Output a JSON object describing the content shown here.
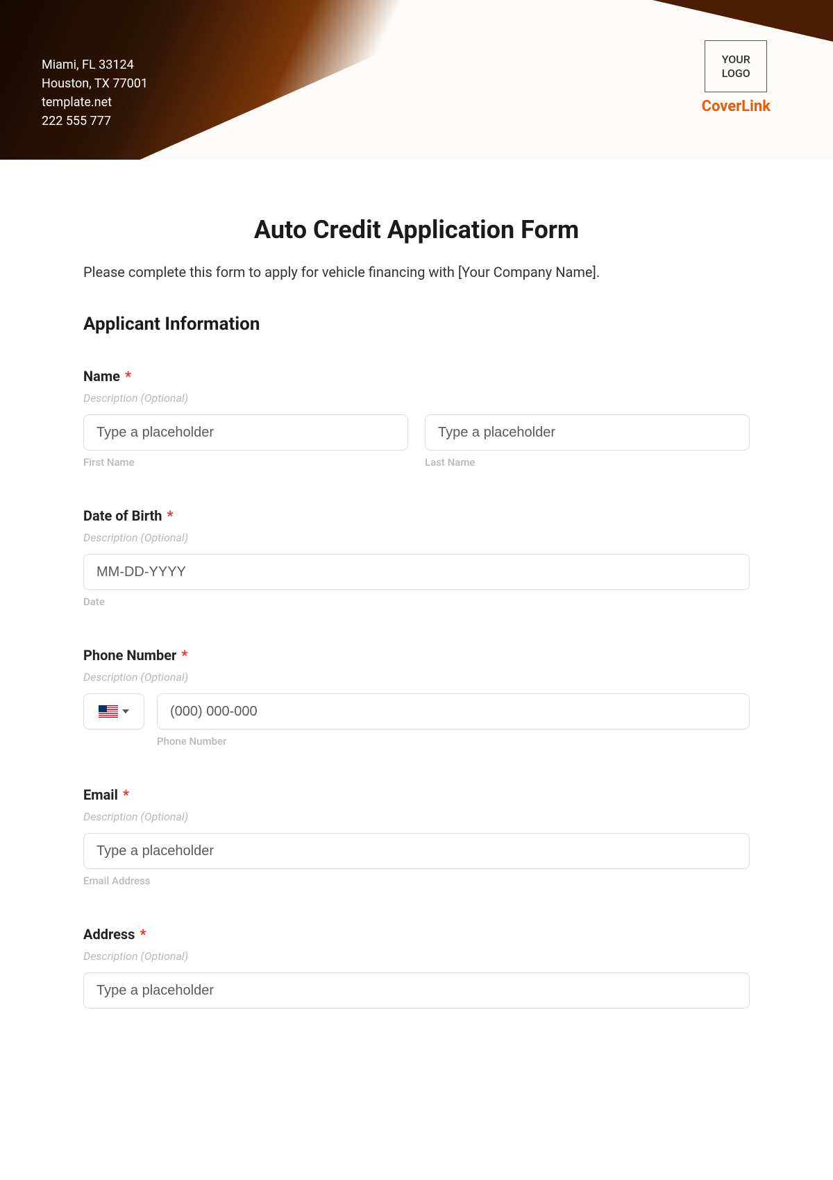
{
  "header": {
    "company_lines": [
      "Miami, FL 33124",
      "Houston, TX 77001",
      "template.net",
      "222 555 777"
    ],
    "logo_line1": "YOUR",
    "logo_line2": "LOGO",
    "brand": "CoverLink"
  },
  "form": {
    "title": "Auto Credit Application Form",
    "intro": "Please complete this form to apply for vehicle financing with [Your Company Name].",
    "section1_title": "Applicant Information",
    "desc_placeholder": "Description (Optional)",
    "required_mark": "*",
    "fields": {
      "name": {
        "label": "Name",
        "first_placeholder": "Type a placeholder",
        "last_placeholder": "Type a placeholder",
        "first_sub": "First Name",
        "last_sub": "Last Name"
      },
      "dob": {
        "label": "Date of Birth",
        "placeholder": "MM-DD-YYYY",
        "sub": "Date"
      },
      "phone": {
        "label": "Phone Number",
        "placeholder": "(000) 000-000",
        "sub": "Phone Number"
      },
      "email": {
        "label": "Email",
        "placeholder": "Type a placeholder",
        "sub": "Email Address"
      },
      "address": {
        "label": "Address",
        "placeholder": "Type a placeholder"
      }
    }
  }
}
